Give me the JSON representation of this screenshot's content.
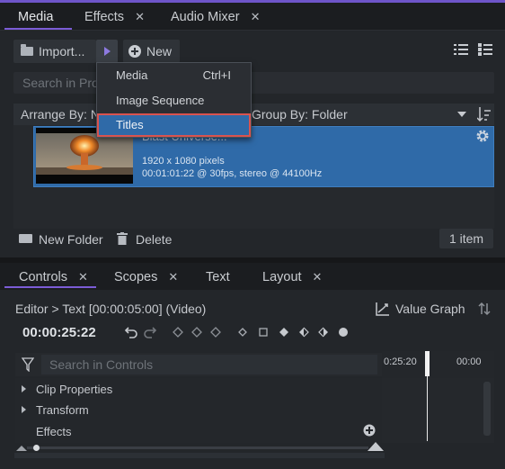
{
  "top_tabs": [
    {
      "label": "Media",
      "closable": false,
      "active": true
    },
    {
      "label": "Effects",
      "closable": true,
      "close_glyph": "✕"
    },
    {
      "label": "Audio Mixer",
      "closable": true,
      "close_glyph": "✕"
    }
  ],
  "media_toolbar": {
    "import_label": "Import...",
    "new_label": "New"
  },
  "import_menu": {
    "items": [
      {
        "label": "Media",
        "shortcut": "Ctrl+I"
      },
      {
        "label": "Image Sequence",
        "shortcut": ""
      },
      {
        "label": "Titles",
        "shortcut": "",
        "selected": true
      }
    ]
  },
  "search_media": {
    "placeholder": "Search in Pro"
  },
  "arrange": {
    "label": "Arrange By: N",
    "group_label": "Group By: Folder"
  },
  "clip": {
    "title": "Blast Universe...",
    "resolution": "1920 x 1080 pixels",
    "details": "00:01:01:22 @ 30fps, stereo @ 44100Hz"
  },
  "media_footer": {
    "new_folder": "New Folder",
    "delete": "Delete",
    "item_count": "1 item"
  },
  "bottom_tabs": [
    {
      "label": "Controls",
      "closable": true,
      "close_glyph": "✕",
      "active": true
    },
    {
      "label": "Scopes",
      "closable": true,
      "close_glyph": "✕"
    },
    {
      "label": "Text",
      "closable": false
    },
    {
      "label": "Layout",
      "closable": true,
      "close_glyph": "✕"
    }
  ],
  "editor": {
    "breadcrumb": "Editor > Text [00:00:05:00] (Video)",
    "value_graph": "Value Graph",
    "timecode": "00:00:25:22"
  },
  "controls_search": {
    "placeholder": "Search in Controls"
  },
  "timeline": {
    "tick_left": "0:25:20",
    "tick_right": "00:00"
  },
  "control_rows": [
    {
      "label": "Clip Properties",
      "expandable": true
    },
    {
      "label": "Transform",
      "expandable": true
    },
    {
      "label": "Effects",
      "expandable": false
    }
  ],
  "colors": {
    "accent_purple": "#7b5cd6",
    "selection_blue": "#2f6aa8",
    "highlight_red": "#d9534f"
  }
}
